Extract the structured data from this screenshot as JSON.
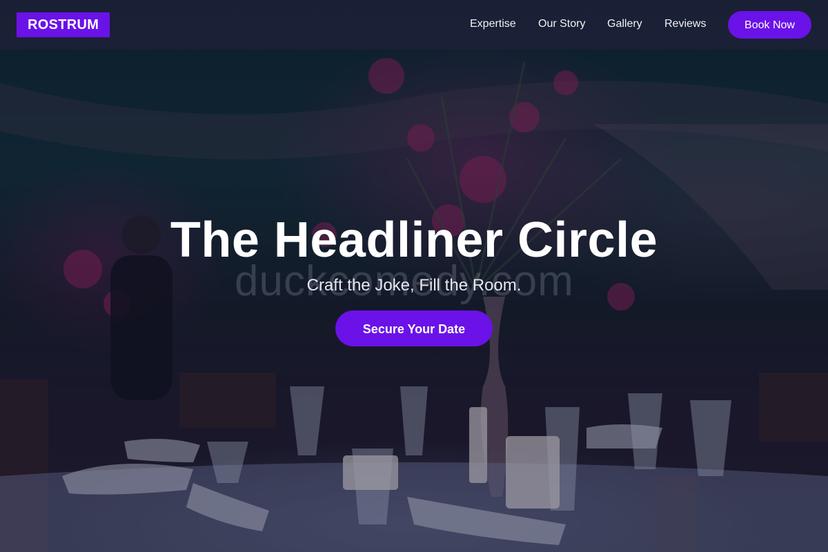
{
  "brand": {
    "name": "ROSTRUM",
    "accent_color": "#6a12e8"
  },
  "nav": {
    "links": [
      {
        "label": "Expertise"
      },
      {
        "label": "Our Story"
      },
      {
        "label": "Gallery"
      },
      {
        "label": "Reviews"
      }
    ],
    "book_label": "Book Now"
  },
  "hero": {
    "title": "The Headliner Circle",
    "subtitle": "Craft the Joke, Fill the Room.",
    "cta_label": "Secure Your Date",
    "watermark": "duckcomedy.com"
  }
}
